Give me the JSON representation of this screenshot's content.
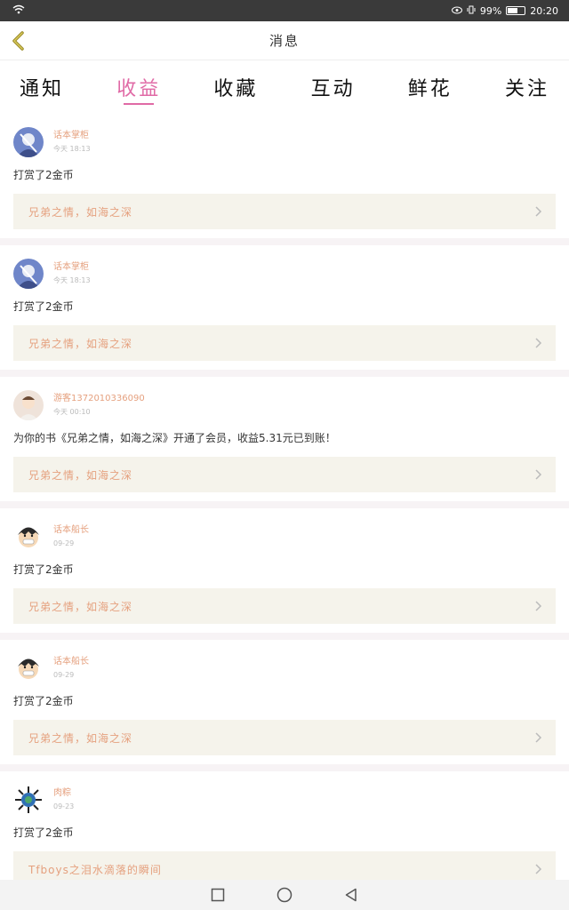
{
  "status_bar": {
    "battery": "99%",
    "time": "20:20"
  },
  "header": {
    "title": "消息"
  },
  "tabs": [
    {
      "label": "通知"
    },
    {
      "label": "收益"
    },
    {
      "label": "收藏"
    },
    {
      "label": "互动"
    },
    {
      "label": "鲜花"
    },
    {
      "label": "关注"
    }
  ],
  "active_tab": "收益",
  "messages": [
    {
      "name": "话本掌柜",
      "time": "今天 18:13",
      "text": "打赏了2金币",
      "book": "兄弟之情，如海之深",
      "avatar": "anime-avatar-blue"
    },
    {
      "name": "话本掌柜",
      "time": "今天 18:13",
      "text": "打赏了2金币",
      "book": "兄弟之情，如海之深",
      "avatar": "anime-avatar-blue"
    },
    {
      "name": "游客1372010336090",
      "time": "今天 00:10",
      "text": "为你的书《兄弟之情，如海之深》开通了会员，收益5.31元已到账！",
      "book": "兄弟之情，如海之深",
      "avatar": "guest-avatar"
    },
    {
      "name": "话本船长",
      "time": "09-29",
      "text": "打赏了2金币",
      "book": "兄弟之情，如海之深",
      "avatar": "cartoon-face-avatar"
    },
    {
      "name": "话本船长",
      "time": "09-29",
      "text": "打赏了2金币",
      "book": "兄弟之情，如海之深",
      "avatar": "cartoon-face-avatar"
    },
    {
      "name": "肉粽",
      "time": "09-23",
      "text": "打赏了2金币",
      "book": "Tfboys之泪水滴落的瞬间",
      "avatar": "virus-avatar"
    }
  ],
  "colors": {
    "accent": "#e06aa6",
    "name": "#e5a07e",
    "book_bg": "#f5f3eb"
  }
}
